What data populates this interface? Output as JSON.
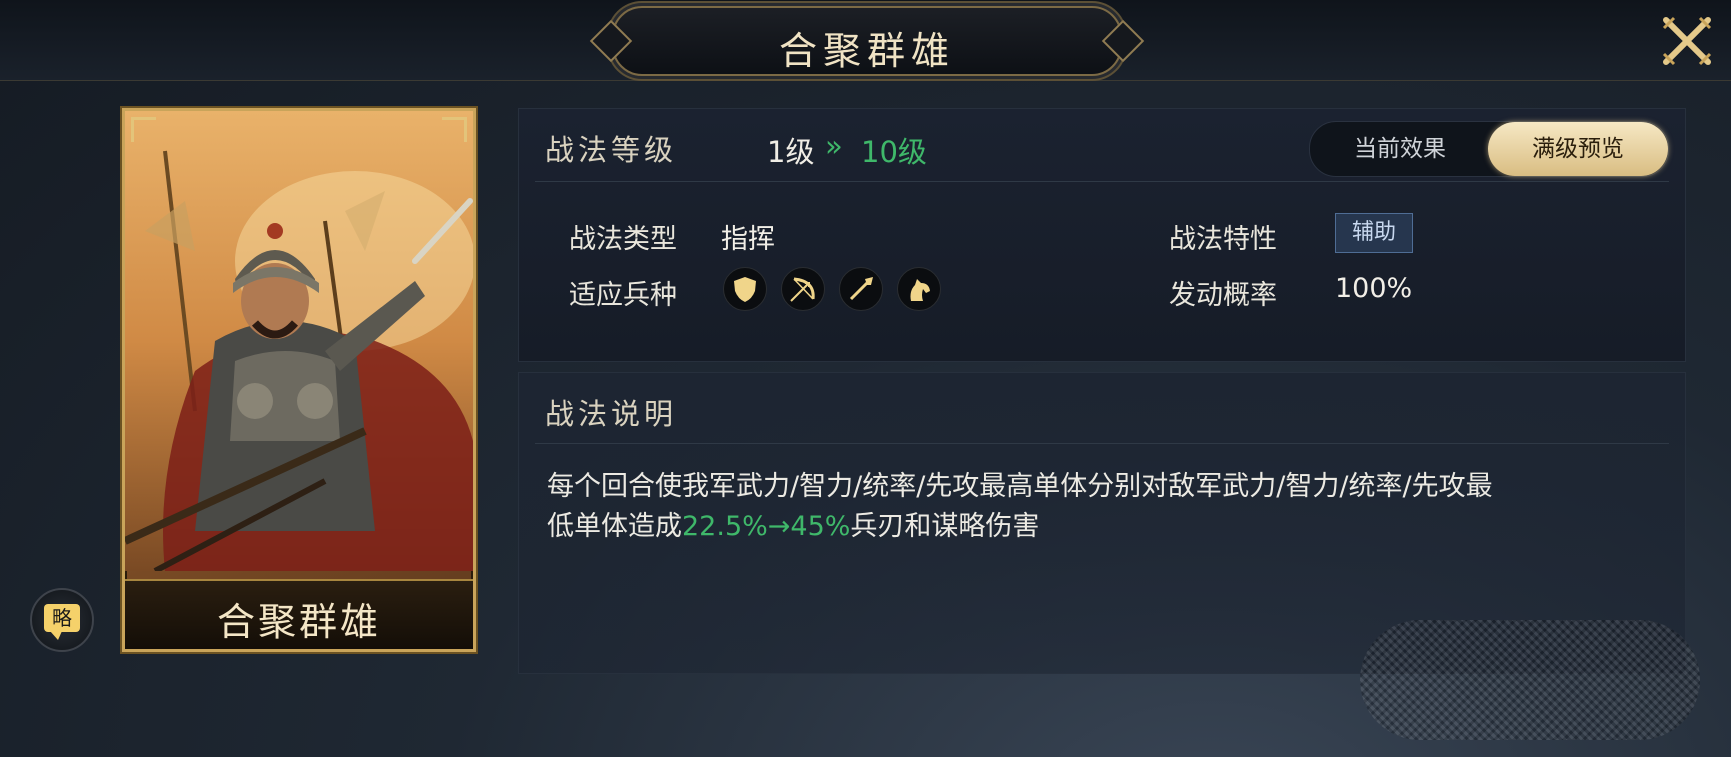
{
  "header": {
    "title": "合聚群雄"
  },
  "card": {
    "name": "合聚群雄"
  },
  "strategy_button": {
    "label": "略"
  },
  "level": {
    "section_label": "战法等级",
    "from": "1级",
    "arrows": "»",
    "to": "10级"
  },
  "toggle": {
    "current": "当前效果",
    "max": "满级预览",
    "selected": "满级预览"
  },
  "stats": {
    "type_label": "战法类型",
    "type_value": "指挥",
    "trait_label": "战法特性",
    "trait_value": "辅助",
    "troops_label": "适应兵种",
    "troop_icons": [
      "shield-icon",
      "bow-icon",
      "spear-icon",
      "horse-icon"
    ],
    "rate_label": "发动概率",
    "rate_value": "100%"
  },
  "description": {
    "section_label": "战法说明",
    "line1": "每个回合使我军武力/智力/统率/先攻最高单体分别对敌军武力/智力/统率/先攻最",
    "line2_prefix": "低单体造成",
    "line2_values": "22.5%→45%",
    "line2_suffix": "兵刃和谋略伤害"
  },
  "colors": {
    "accent_green": "#3fb86a",
    "gold": "#c9a45a",
    "badge_bg": "#26364e"
  }
}
